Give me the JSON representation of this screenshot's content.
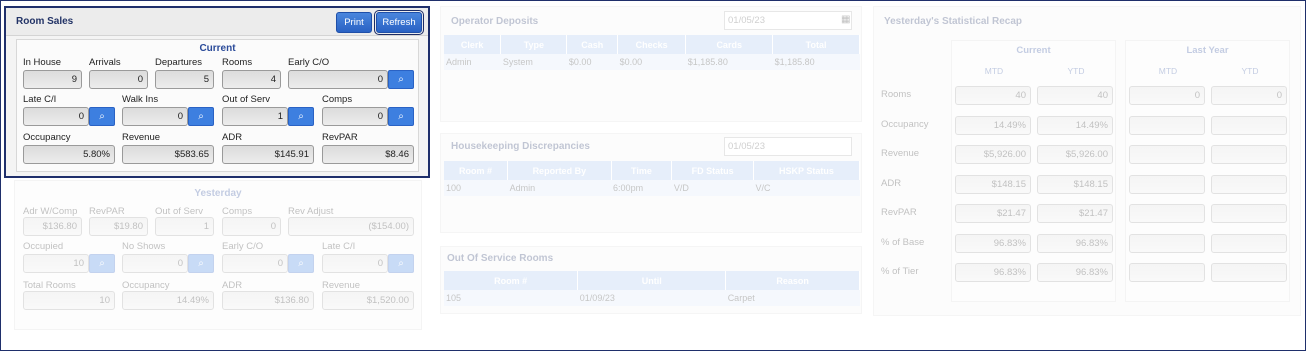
{
  "room_sales": {
    "title": "Room Sales",
    "print_label": "Print",
    "refresh_label": "Refresh",
    "current_title": "Current",
    "in_house": {
      "label": "In House",
      "value": "9"
    },
    "arrivals": {
      "label": "Arrivals",
      "value": "0"
    },
    "departures": {
      "label": "Departures",
      "value": "5"
    },
    "rooms": {
      "label": "Rooms",
      "value": "4"
    },
    "early_co": {
      "label": "Early C/O",
      "value": "0"
    },
    "late_ci": {
      "label": "Late C/I",
      "value": "0"
    },
    "walk_ins": {
      "label": "Walk Ins",
      "value": "0"
    },
    "out_of_serv": {
      "label": "Out of Serv",
      "value": "1"
    },
    "comps": {
      "label": "Comps",
      "value": "0"
    },
    "occupancy": {
      "label": "Occupancy",
      "value": "5.80%"
    },
    "revenue": {
      "label": "Revenue",
      "value": "$583.65"
    },
    "adr": {
      "label": "ADR",
      "value": "$145.91"
    },
    "revpar": {
      "label": "RevPAR",
      "value": "$8.46"
    }
  },
  "yesterday": {
    "title": "Yesterday",
    "adr_wcomp": {
      "label": "Adr W/Comp",
      "value": "$136.80"
    },
    "revpar": {
      "label": "RevPAR",
      "value": "$19.80"
    },
    "out_of_serv": {
      "label": "Out of Serv",
      "value": "1"
    },
    "comps": {
      "label": "Comps",
      "value": "0"
    },
    "rev_adjust": {
      "label": "Rev Adjust",
      "value": "($154.00)"
    },
    "occupied": {
      "label": "Occupied",
      "value": "10"
    },
    "no_shows": {
      "label": "No Shows",
      "value": "0"
    },
    "early_co": {
      "label": "Early C/O",
      "value": "0"
    },
    "late_ci": {
      "label": "Late C/I",
      "value": "0"
    },
    "total_rooms": {
      "label": "Total Rooms",
      "value": "10"
    },
    "occupancy": {
      "label": "Occupancy",
      "value": "14.49%"
    },
    "adr": {
      "label": "ADR",
      "value": "$136.80"
    },
    "revenue": {
      "label": "Revenue",
      "value": "$1,520.00"
    }
  },
  "operator_deposits": {
    "title": "Operator Deposits",
    "date": "01/05/23",
    "columns": [
      "Clerk",
      "Type",
      "Cash",
      "Checks",
      "Cards",
      "Total"
    ],
    "rows": [
      [
        "Admin",
        "System",
        "$0.00",
        "$0.00",
        "$1,185.80",
        "$1,185.80"
      ]
    ]
  },
  "housekeeping": {
    "title": "Housekeeping Discrepancies",
    "date": "01/05/23",
    "columns": [
      "Room #",
      "Reported By",
      "Time",
      "FD Status",
      "HSKP Status"
    ],
    "rows": [
      [
        "100",
        "Admin",
        "6:00pm",
        "V/D",
        "V/C"
      ]
    ]
  },
  "out_of_service": {
    "title": "Out Of Service Rooms",
    "columns": [
      "Room #",
      "Until",
      "Reason"
    ],
    "rows": [
      [
        "105",
        "01/09/23",
        "Carpet"
      ]
    ]
  },
  "recap": {
    "title": "Yesterday's Statistical Recap",
    "current": "Current",
    "last_year": "Last Year",
    "mtd": "MTD",
    "ytd": "YTD",
    "rows": [
      {
        "label": "Rooms",
        "cur_mtd": "40",
        "cur_ytd": "40",
        "ly_mtd": "0",
        "ly_ytd": "0"
      },
      {
        "label": "Occupancy",
        "cur_mtd": "14.49%",
        "cur_ytd": "14.49%",
        "ly_mtd": "",
        "ly_ytd": ""
      },
      {
        "label": "Revenue",
        "cur_mtd": "$5,926.00",
        "cur_ytd": "$5,926.00",
        "ly_mtd": "",
        "ly_ytd": ""
      },
      {
        "label": "ADR",
        "cur_mtd": "$148.15",
        "cur_ytd": "$148.15",
        "ly_mtd": "",
        "ly_ytd": ""
      },
      {
        "label": "RevPAR",
        "cur_mtd": "$21.47",
        "cur_ytd": "$21.47",
        "ly_mtd": "",
        "ly_ytd": ""
      },
      {
        "label": "% of Base",
        "cur_mtd": "96.83%",
        "cur_ytd": "96.83%",
        "ly_mtd": "",
        "ly_ytd": ""
      },
      {
        "label": "% of Tier",
        "cur_mtd": "96.83%",
        "cur_ytd": "96.83%",
        "ly_mtd": "",
        "ly_ytd": ""
      }
    ]
  },
  "icons": {
    "search": "magnifier-icon",
    "calendar": "calendar-icon"
  }
}
